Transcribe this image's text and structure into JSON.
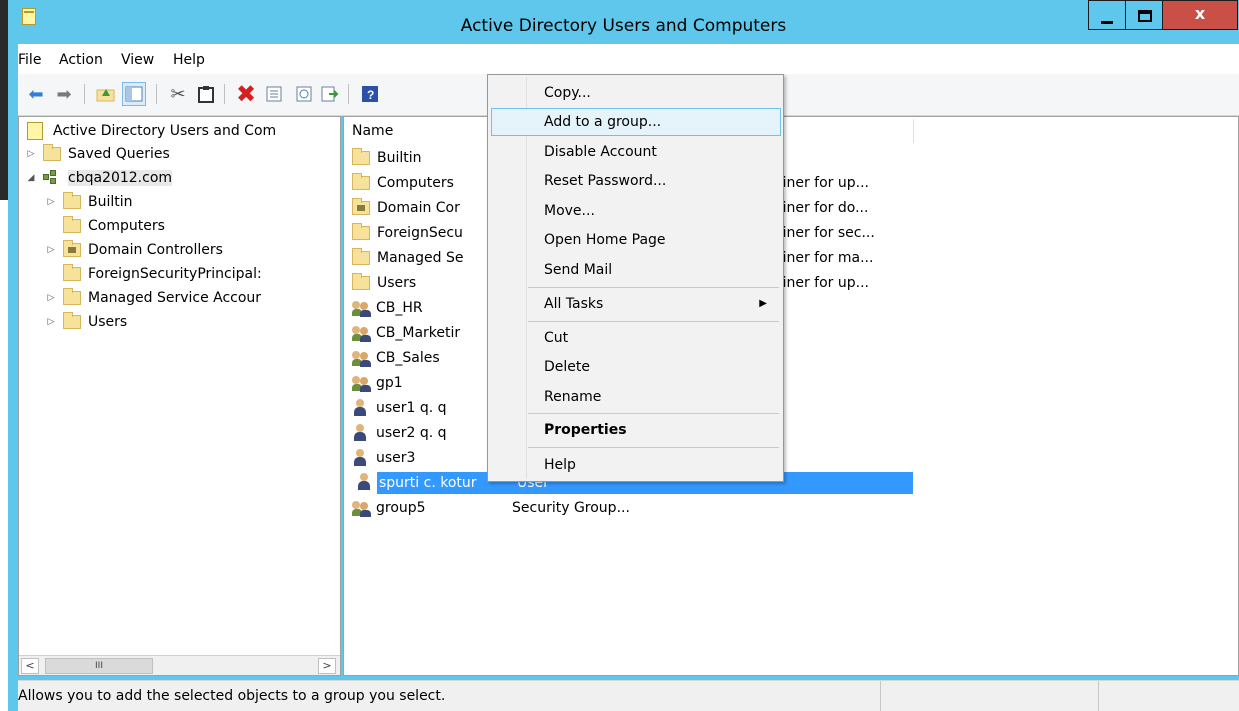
{
  "window": {
    "title": "Active Directory Users and Computers",
    "close_label": "x"
  },
  "menu": [
    "File",
    "Action",
    "View",
    "Help"
  ],
  "tree": {
    "root": "Active Directory Users and Com",
    "saved_queries": "Saved Queries",
    "domain": "cbqa2012.com",
    "children": [
      "Builtin",
      "Computers",
      "Domain Controllers",
      "ForeignSecurityPrincipal:",
      "Managed Service Accour",
      "Users"
    ],
    "users_top": "Users"
  },
  "list": {
    "header_name": "Name",
    "items": [
      {
        "name": "Builtin",
        "type": ""
      },
      {
        "name": "Computers",
        "type": "ainer for up..."
      },
      {
        "name": "Domain Cor",
        "type": "ainer for do..."
      },
      {
        "name": "ForeignSecu",
        "type": "ainer for sec..."
      },
      {
        "name": "Managed Se",
        "type": "ainer for ma..."
      },
      {
        "name": "Users",
        "type": "ainer for up..."
      },
      {
        "name": "CB_HR",
        "type": ""
      },
      {
        "name": "CB_Marketir",
        "type": ""
      },
      {
        "name": "CB_Sales",
        "type": ""
      },
      {
        "name": "gp1",
        "type": ""
      },
      {
        "name": "user1 q. q",
        "type": ""
      },
      {
        "name": "user2 q. q",
        "type": ""
      },
      {
        "name": "user3",
        "type": ""
      },
      {
        "name": "spurti c. kotur",
        "type": "User"
      },
      {
        "name": "group5",
        "type": "Security Group..."
      }
    ]
  },
  "context_menu": {
    "copy": "Copy...",
    "add_to_group": "Add to a group...",
    "disable": "Disable Account",
    "reset_password": "Reset Password...",
    "move": "Move...",
    "open_home": "Open Home Page",
    "send_mail": "Send Mail",
    "all_tasks": "All Tasks",
    "cut": "Cut",
    "delete": "Delete",
    "rename": "Rename",
    "properties": "Properties",
    "help": "Help"
  },
  "status": {
    "text": "Allows you to add the selected objects to a group you select."
  },
  "scrollbar": {
    "thumb_grip": "III",
    "left_arrow": "<",
    "right_arrow": ">"
  },
  "icons": [
    "back-arrow-icon",
    "forward-arrow-icon",
    "up-folder-icon",
    "show-hide-tree-icon",
    "cut-icon",
    "paste-icon",
    "delete-icon",
    "properties-icon",
    "refresh-icon",
    "export-icon",
    "help-icon"
  ],
  "colors": {
    "titlebar": "#5fc7ec",
    "close": "#c94f47",
    "selection": "#3399ff",
    "menu_highlight": "#e5f3fb"
  }
}
